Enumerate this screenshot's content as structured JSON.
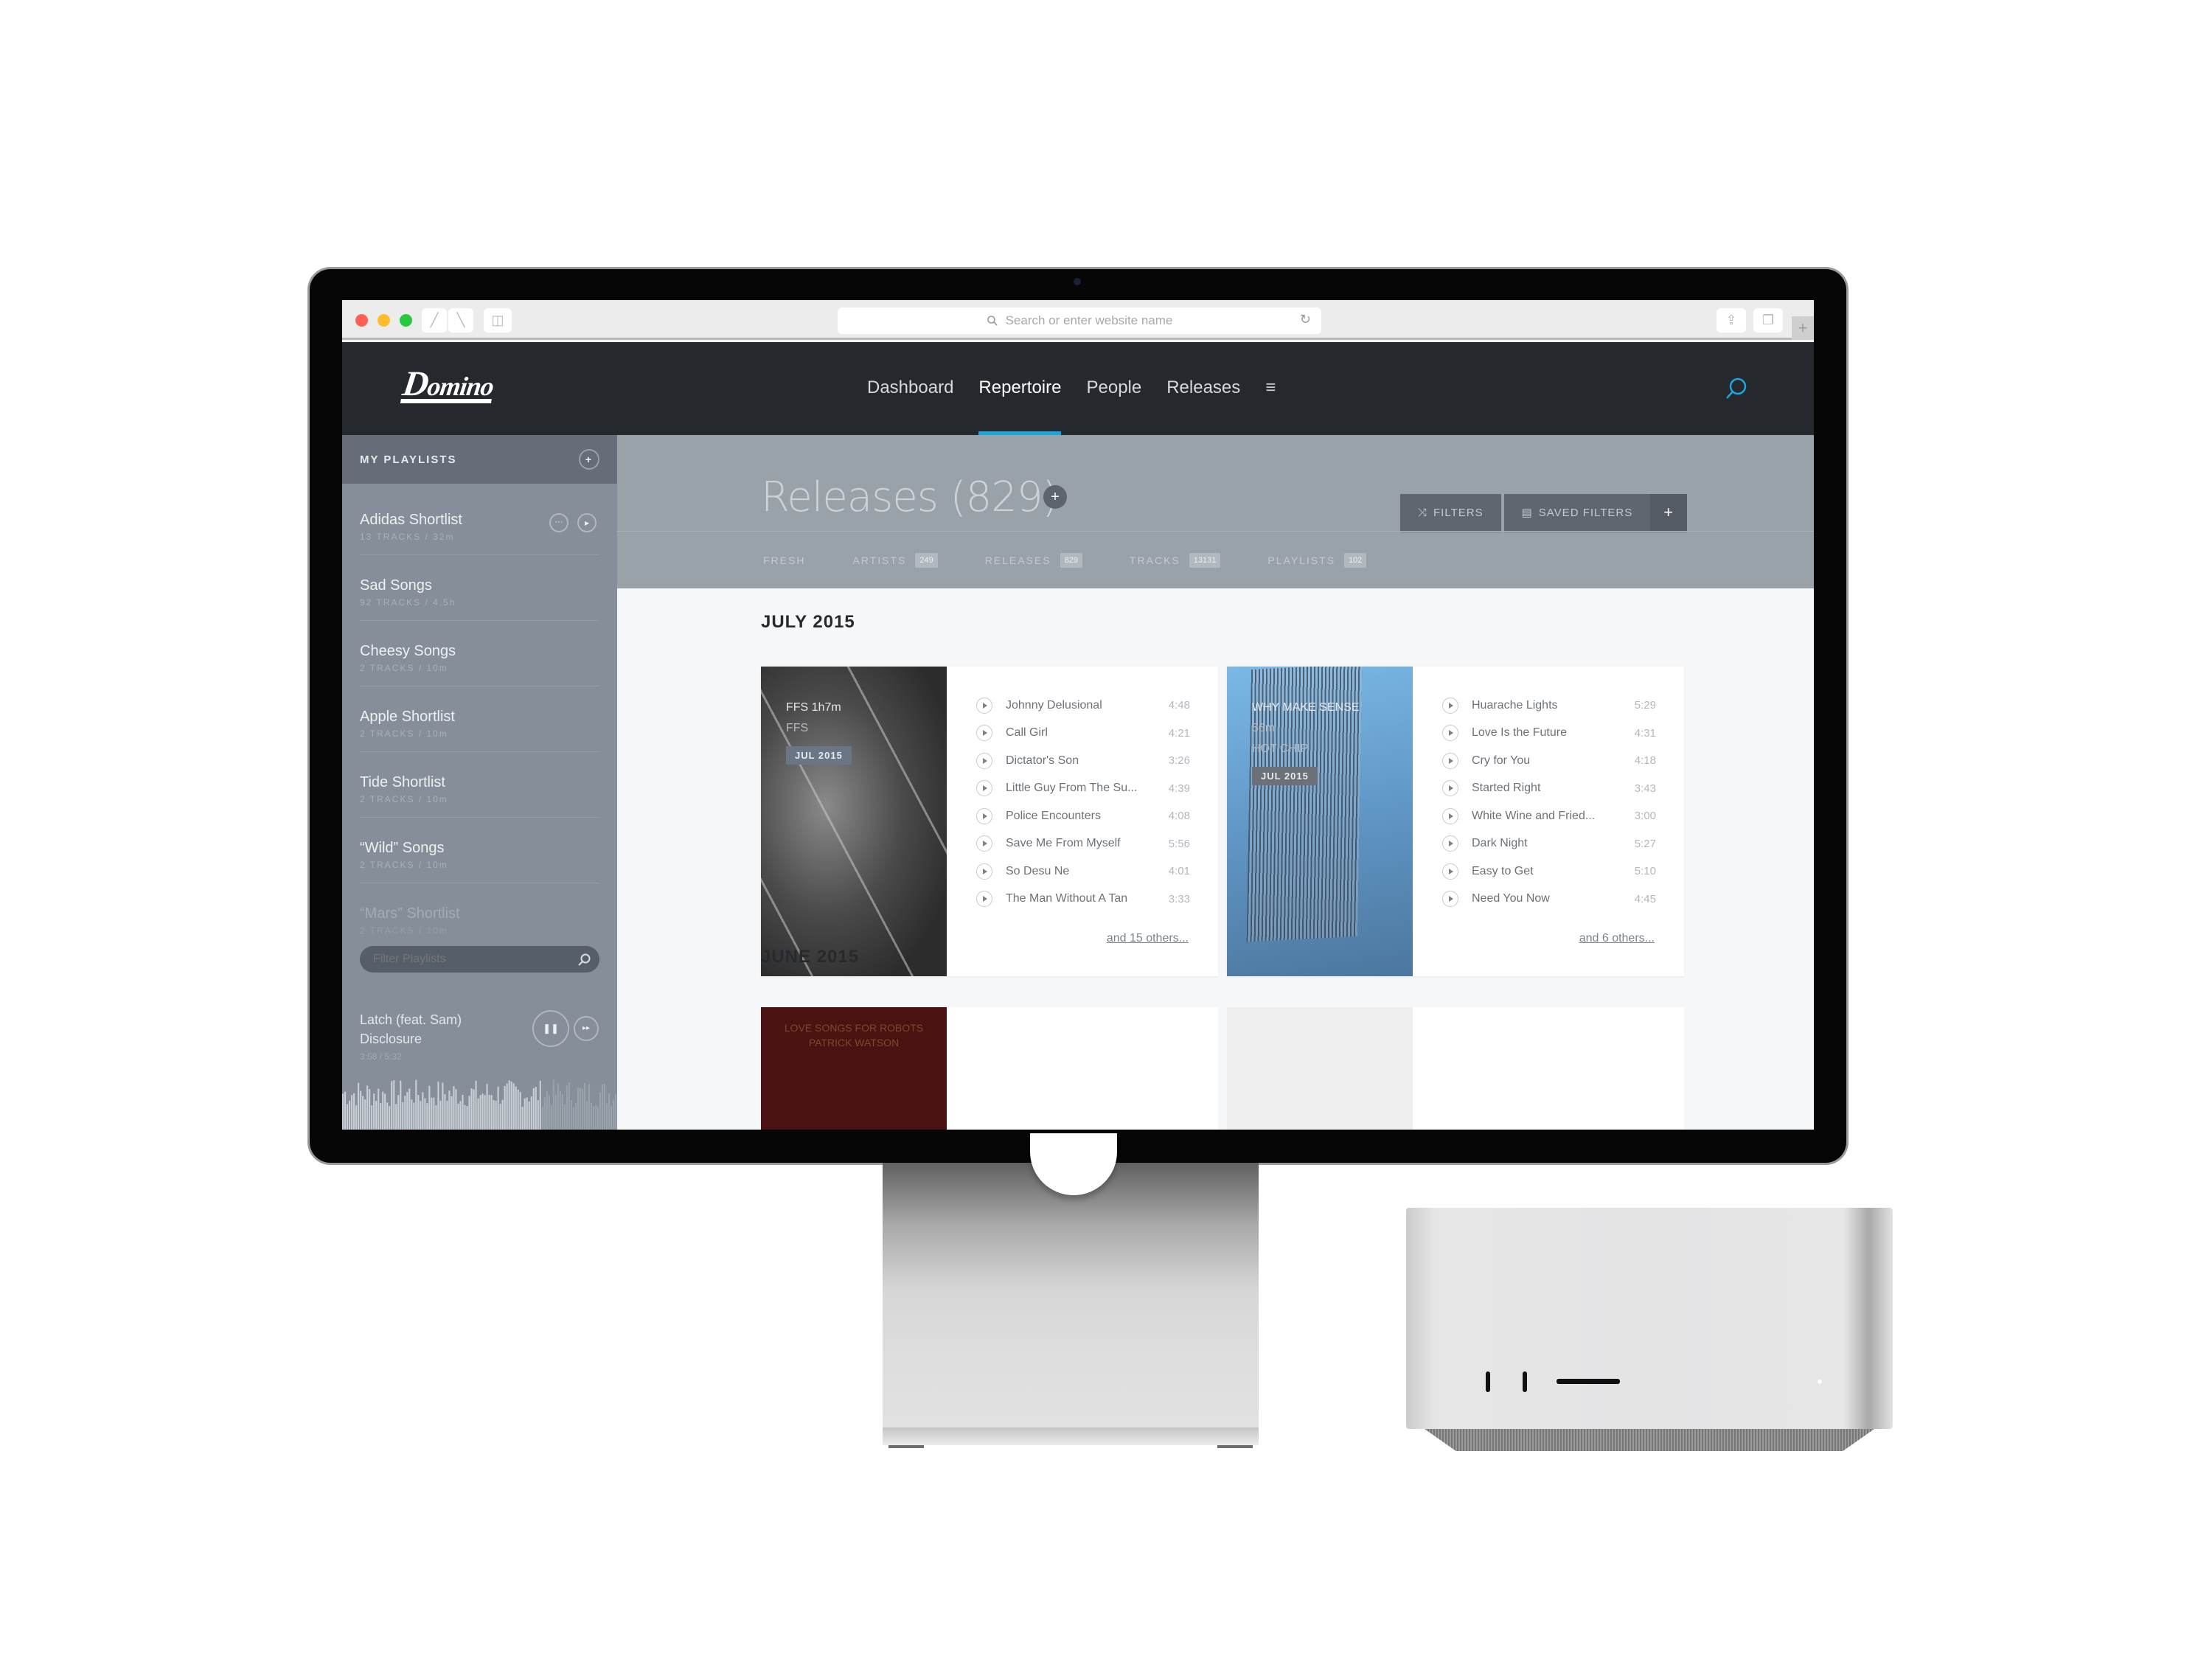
{
  "browser": {
    "url_placeholder": "Search or enter website name",
    "icons": [
      "back-icon",
      "forward-icon",
      "sidebar-icon",
      "share-icon",
      "tabs-icon",
      "new-tab-icon"
    ]
  },
  "app": {
    "logo_initial": "D",
    "logo_rest": "omino",
    "nav": [
      {
        "label": "Dashboard",
        "active": false
      },
      {
        "label": "Repertoire",
        "active": true
      },
      {
        "label": "People",
        "active": false
      },
      {
        "label": "Releases",
        "active": false
      }
    ],
    "menu_icon": "≡",
    "accent_color": "#1ea5e0"
  },
  "sidebar": {
    "title": "MY PLAYLISTS",
    "add_icon": "+",
    "playlists": [
      {
        "name": "Adidas Shortlist",
        "meta": "13 TRACKS / 32m"
      },
      {
        "name": "Sad Songs",
        "meta": "92 TRACKS / 4.5h"
      },
      {
        "name": "Cheesy Songs",
        "meta": "2 TRACKS / 10m"
      },
      {
        "name": "Apple Shortlist",
        "meta": "2 TRACKS / 10m"
      },
      {
        "name": "Tide Shortlist",
        "meta": "2 TRACKS / 10m"
      },
      {
        "name": "“Wild” Songs",
        "meta": "2 TRACKS / 10m"
      },
      {
        "name": "“Mars” Shortlist",
        "meta": "2 TRACKS / 10m"
      }
    ],
    "more_icon": "···",
    "play_icon": "▸",
    "filter_placeholder": "Filter Playlists",
    "now_playing": {
      "title": "Latch (feat. Sam)",
      "artist": "Disclosure",
      "time": "3:58 / 5:32",
      "progress": 0.72,
      "pause_icon": "❚❚",
      "next_icon": "▸▸"
    }
  },
  "main": {
    "title": "Releases (829)",
    "title_add_icon": "+",
    "buttons": {
      "filters": "FILTERS",
      "saved_filters": "SAVED FILTERS",
      "add": "+"
    },
    "tabs": [
      {
        "label": "FRESH",
        "badge": null
      },
      {
        "label": "ARTISTS",
        "badge": "249"
      },
      {
        "label": "RELEASES",
        "badge": "829"
      },
      {
        "label": "TRACKS",
        "badge": "13131"
      },
      {
        "label": "PLAYLISTS",
        "badge": "102"
      }
    ],
    "sections": [
      {
        "month": "JULY 2015",
        "releases": [
          {
            "title": "FFS 1h7m",
            "artist": "FFS",
            "date": "JUL 2015",
            "tracks": [
              {
                "name": "Johnny Delusional",
                "duration": "4:48"
              },
              {
                "name": "Call Girl",
                "duration": "4:21"
              },
              {
                "name": "Dictator's Son",
                "duration": "3:26"
              },
              {
                "name": "Little Guy From The Su...",
                "duration": "4:39"
              },
              {
                "name": "Police Encounters",
                "duration": "4:08"
              },
              {
                "name": "Save Me From Myself",
                "duration": "5:56"
              },
              {
                "name": "So Desu Ne",
                "duration": "4:01"
              },
              {
                "name": "The Man Without A Tan",
                "duration": "3:33"
              }
            ],
            "more": "and 15 others..."
          },
          {
            "title": "WHY MAKE SENSE",
            "length": "56m",
            "artist": "HOT CHIP",
            "date": "JUL 2015",
            "tracks": [
              {
                "name": "Huarache Lights",
                "duration": "5:29"
              },
              {
                "name": "Love Is the Future",
                "duration": "4:31"
              },
              {
                "name": "Cry for You",
                "duration": "4:18"
              },
              {
                "name": "Started Right",
                "duration": "3:43"
              },
              {
                "name": "White Wine and Fried...",
                "duration": "3:00"
              },
              {
                "name": "Dark Night",
                "duration": "5:27"
              },
              {
                "name": "Easy to Get",
                "duration": "5:10"
              },
              {
                "name": "Need You Now",
                "duration": "4:45"
              }
            ],
            "more": "and 6 others..."
          }
        ]
      },
      {
        "month": "JUNE 2015",
        "releases": [
          {
            "title": "LOVE SONGS FOR ROBOTS",
            "artist": "PATRICK WATSON"
          }
        ]
      }
    ]
  }
}
